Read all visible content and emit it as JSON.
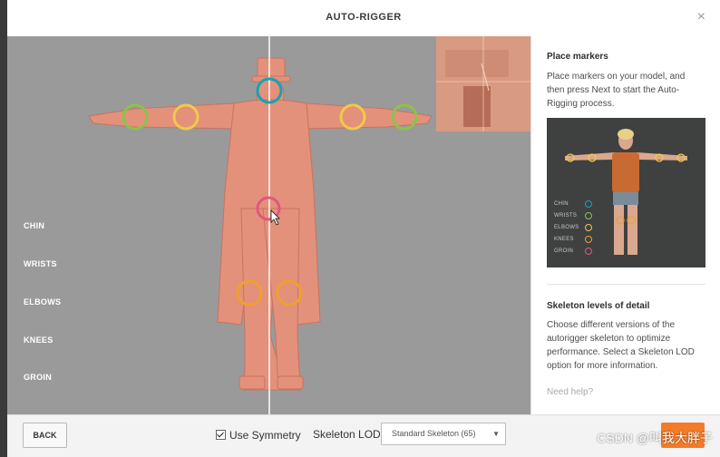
{
  "window": {
    "title": "AUTO-RIGGER",
    "close_glyph": "×"
  },
  "viewport": {
    "legend": [
      "CHIN",
      "WRISTS",
      "ELBOWS",
      "KNEES",
      "GROIN"
    ],
    "marker_colors": {
      "chin": "#16a3b5",
      "wrists": "#8bc34a",
      "elbows": "#f0c94a",
      "knees": "#f0a030",
      "groin": "#e0577c"
    },
    "model_color": "#e3917a",
    "background_color": "#9a9a9a"
  },
  "side": {
    "place_title": "Place markers",
    "place_text": "Place markers on your model, and then press Next to start the Auto-Rigging process.",
    "preview_legend": [
      "CHIN",
      "WRISTS",
      "ELBOWS",
      "KNEES",
      "GROIN"
    ],
    "lod_title": "Skeleton levels of detail",
    "lod_text": "Choose different versions of the autorigger skeleton to optimize performance. Select a Skeleton LOD option for more information.",
    "need_help": "Need help?"
  },
  "footer": {
    "back_label": "BACK",
    "symmetry_label": "Use Symmetry",
    "symmetry_checked": true,
    "lod_label": "Skeleton LOD",
    "lod_value": "Standard Skeleton (65)",
    "accent_color": "#f47b2a"
  },
  "watermark": "CSDN @叫我大胖子"
}
